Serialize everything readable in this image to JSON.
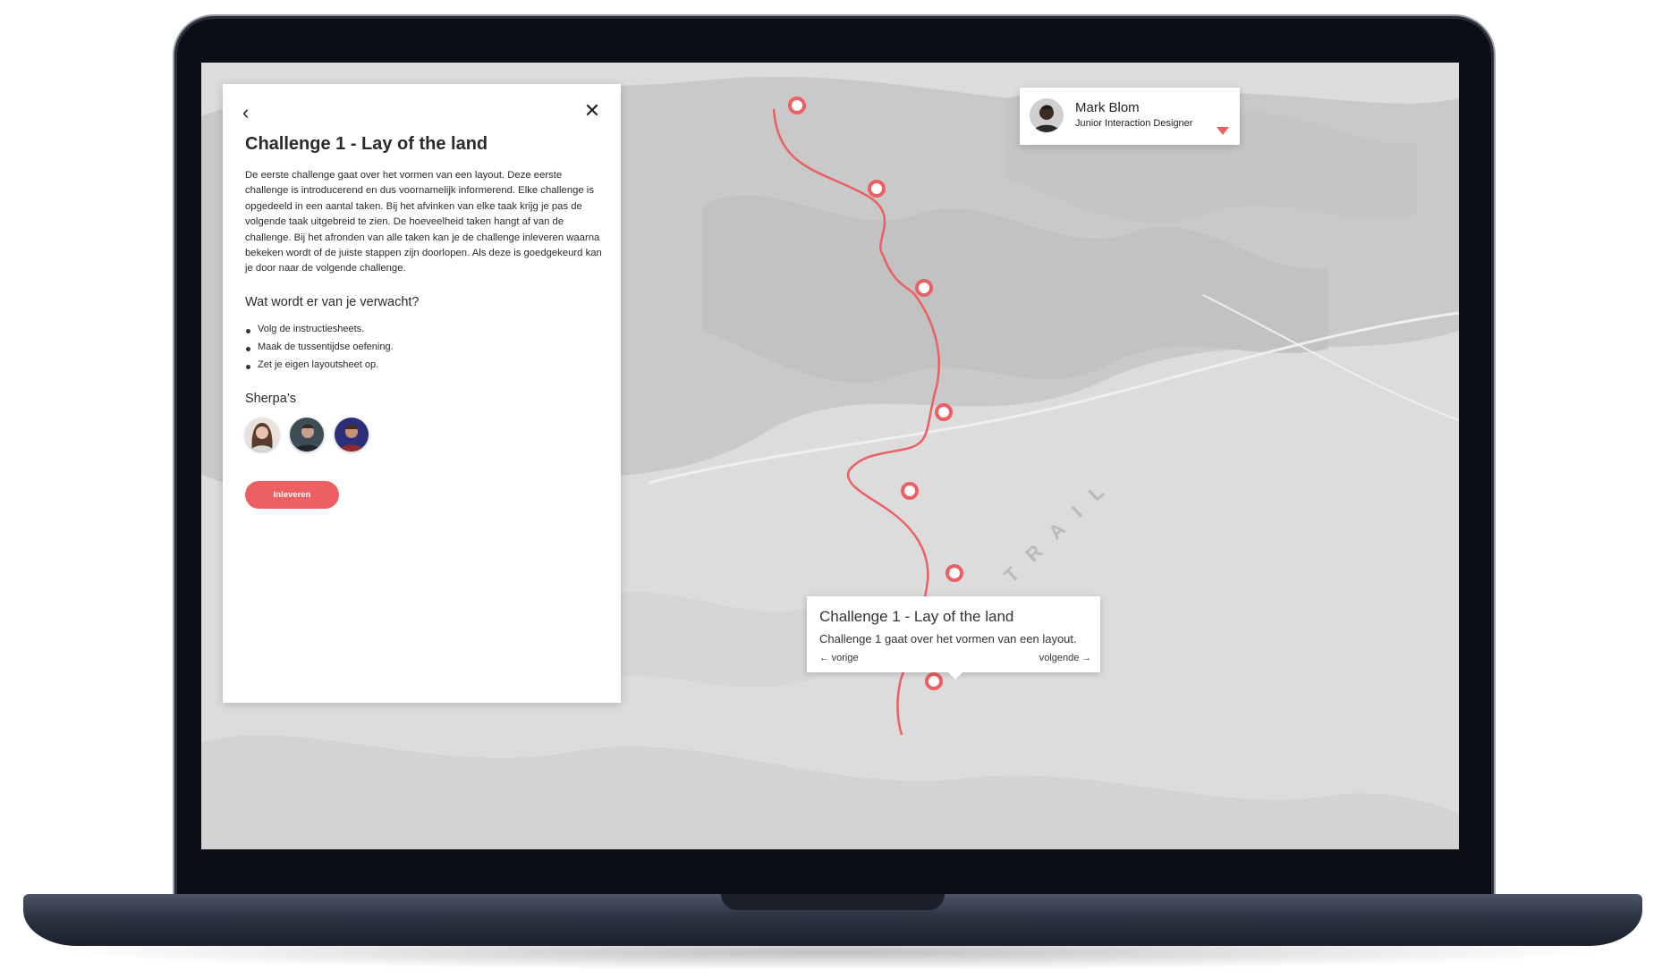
{
  "panel": {
    "back_icon": "chevron-left-icon",
    "close_icon": "close-icon",
    "title": "Challenge 1 - Lay of the land",
    "description": "De eerste challenge gaat over het vormen van een layout. Deze eerste challenge is introducerend en dus voornamelijk informerend. Elke challenge is opgedeeld in een aantal taken. Bij het afvinken van elke taak krijg je pas de volgende taak uitgebreid te zien. De hoeveelheid taken hangt af van de challenge. Bij het afronden van alle taken kan je de challenge inleveren waarna bekeken wordt of de juiste stappen zijn doorlopen. Als deze is goedgekeurd kan je door naar de volgende challenge.",
    "expectations_heading": "Wat wordt er van je verwacht?",
    "expectations": [
      "Volg de instructiesheets.",
      "Maak de tussentijdse oefening.",
      "Zet je eigen layoutsheet op."
    ],
    "sherpas_heading": "Sherpa’s",
    "submit_label": "Inleveren"
  },
  "user": {
    "name": "Mark Blom",
    "role": "Junior Interaction Designer"
  },
  "map": {
    "trail_label": "UI TRAIL",
    "accent_color": "#ec5f62"
  },
  "tooltip": {
    "title": "Challenge 1 - Lay of the land",
    "description": "Challenge 1 gaat over het vormen van een layout.",
    "prev_label": "vorige",
    "next_label": "volgende"
  }
}
